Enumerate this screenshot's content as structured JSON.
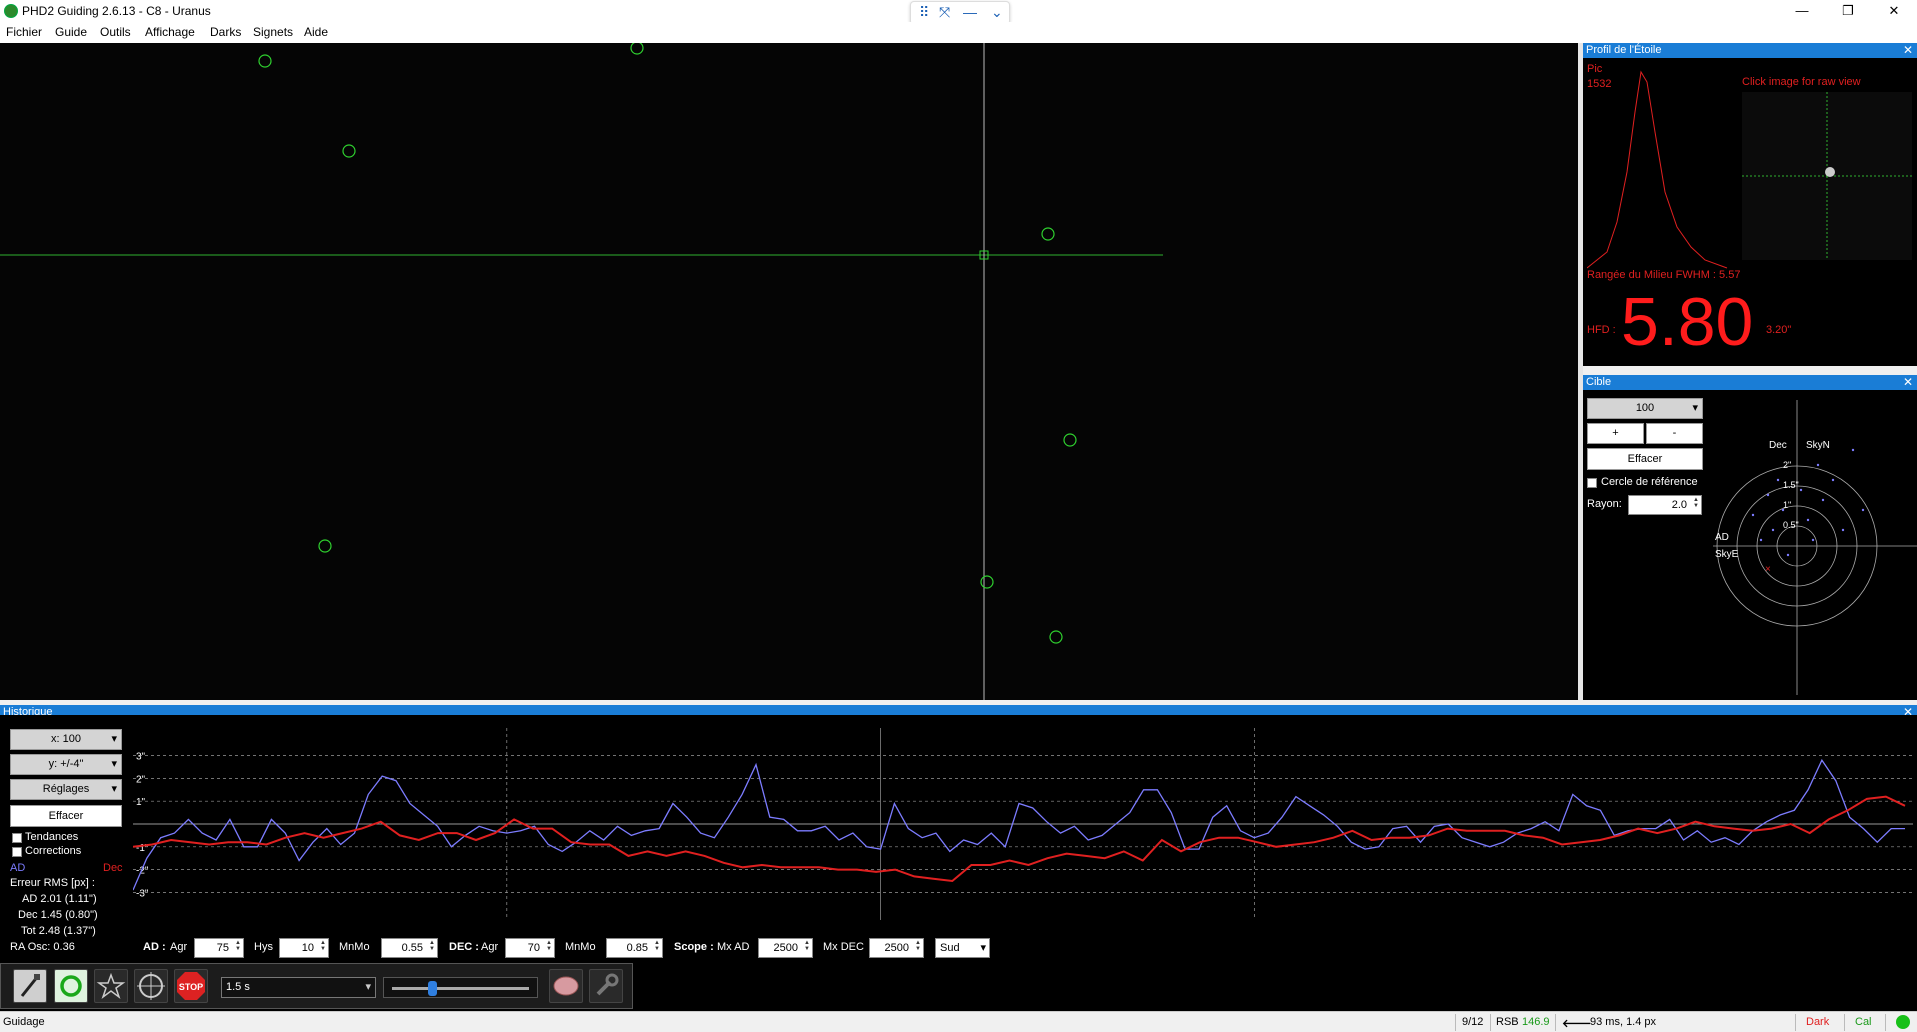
{
  "window": {
    "title": "PHD2 Guiding 2.6.13 - C8 - Uranus",
    "minimize": "—",
    "maximize": "❐",
    "close": "✕"
  },
  "menu": [
    "Fichier",
    "Guide",
    "Outils",
    "Affichage",
    "Darks",
    "Signets",
    "Aide"
  ],
  "profile": {
    "title": "Profil de l'Étoile",
    "close": "✕",
    "peak_label": "Pic",
    "peak_value": "1532",
    "hint": "Click image for raw view",
    "fwhm": "Rangée du Milieu FWHM : 5.57",
    "hfd_label": "HFD :",
    "hfd_value": "5.80",
    "hfd_arcsec": "3.20\""
  },
  "target": {
    "title": "Cible",
    "close": "✕",
    "scale": "100",
    "plus": "+",
    "minus": "-",
    "clear": "Effacer",
    "ref_circle": "Cercle de référence",
    "radius_label": "Rayon:",
    "radius_value": "2.0",
    "dec_label": "Dec",
    "skyn": "SkyN",
    "ad_label": "AD",
    "skye": "SkyE",
    "rings": [
      "2\"",
      "1.5\"",
      "1\"",
      "0.5\""
    ]
  },
  "history": {
    "title": "Historique",
    "close": "✕",
    "x_scale": "x: 100",
    "y_scale": "y: +/-4\"",
    "settings": "Réglages",
    "clear": "Effacer",
    "trends": "Tendances",
    "corrections": "Corrections",
    "ra_legend": "AD",
    "dec_legend": "Dec",
    "rms_title": "Erreur RMS [px] :",
    "rms_ra": "AD 2.01 (1.11\")",
    "rms_dec": "Dec 1.45 (0.80\")",
    "rms_tot": "Tot 2.48 (1.37\")",
    "ra_osc": "RA Osc: 0.36",
    "y_ticks": [
      "3\"",
      "2\"",
      "1\"",
      "-1\"",
      "-2\"",
      "-3\""
    ]
  },
  "params": {
    "ad_label": "AD :",
    "agr_label": "Agr",
    "ad_agr": "75",
    "hys_label": "Hys",
    "hys": "10",
    "mnmo_label": "MnMo",
    "ad_mnmo": "0.55",
    "dec_label": "DEC :",
    "dec_agr": "70",
    "dec_mnmo": "0.85",
    "scope_label": "Scope :",
    "mxad_label": "Mx AD",
    "mxad": "2500",
    "mxdec_label": "Mx DEC",
    "mxdec": "2500",
    "dec_mode": "Sud"
  },
  "toolbar": {
    "exposure": "1.5 s",
    "stop": "STOP"
  },
  "status": {
    "state": "Guidage",
    "frames": "9/12",
    "snr_label": "RSB",
    "snr": "146.9",
    "guide": "93 ms, 1.4 px",
    "dark": "Dark",
    "cal": "Cal"
  },
  "colors": {
    "accent": "#1a7dd6",
    "ra": "#7c7cff",
    "dec": "#e02020",
    "star_marker": "#2fd12f"
  },
  "chart_data": {
    "type": "line",
    "ylim": [
      -4,
      4
    ],
    "series": [
      {
        "name": "AD",
        "values": [
          -2.9,
          -1.5,
          -0.6,
          -0.4,
          0.2,
          -0.4,
          -0.7,
          0.2,
          -1.0,
          -1.0,
          0.2,
          -0.4,
          -1.6,
          -0.8,
          -0.2,
          -0.9,
          -0.4,
          1.3,
          2.1,
          1.9,
          0.9,
          0.4,
          -0.1,
          -1.0,
          -0.5,
          -0.1,
          -0.3,
          -0.4,
          -0.3,
          -0.1,
          -0.9,
          -1.2,
          -0.8,
          -0.3,
          -0.7,
          -0.1,
          -0.5,
          -0.3,
          -0.2,
          0.9,
          0.3,
          -0.4,
          -0.6,
          0.3,
          1.3,
          2.6,
          0.3,
          0.2,
          -0.3,
          -0.3,
          -0.1,
          -0.7,
          -0.4,
          -1.0,
          -1.1,
          0.9,
          -0.2,
          -0.6,
          -0.4,
          -1.2,
          -0.7,
          -0.9,
          -0.4,
          -1.0,
          0.9,
          0.7,
          0.1,
          -0.4,
          -0.1,
          -0.7,
          -0.5,
          0.0,
          0.5,
          1.5,
          1.5,
          0.5,
          -1.1,
          -1.1,
          0.3,
          0.8,
          -0.3,
          -0.6,
          -0.4,
          0.3,
          1.2,
          0.8,
          0.4,
          -0.1,
          -0.8,
          -1.1,
          -1.0,
          -0.2,
          -0.1,
          -0.8,
          -0.1,
          0.0,
          -0.6,
          -0.8,
          -1.0,
          -0.8,
          -0.4,
          -0.2,
          0.1,
          -0.3,
          1.3,
          0.8,
          0.6,
          -0.5,
          -0.3,
          -0.2,
          -0.2,
          0.2,
          -0.7,
          -0.3,
          -0.8,
          -0.6,
          -0.9,
          -0.3,
          0.1,
          0.4,
          0.6,
          1.5,
          2.8,
          1.9,
          0.3,
          -0.2,
          -0.8,
          -0.2,
          -0.2
        ],
        "color": "#7c7cff"
      },
      {
        "name": "Dec",
        "values": [
          -1.0,
          -0.9,
          -0.7,
          -0.8,
          -0.9,
          -0.8,
          -0.8,
          -0.9,
          -0.6,
          -0.4,
          -0.6,
          -0.4,
          -0.2,
          0.1,
          -0.5,
          -0.7,
          -0.4,
          -0.4,
          -0.7,
          -0.4,
          0.2,
          -0.2,
          -0.2,
          -0.8,
          -0.9,
          -0.9,
          -1.4,
          -1.2,
          -1.4,
          -1.2,
          -1.4,
          -1.7,
          -1.9,
          -1.8,
          -1.9,
          -1.9,
          -1.9,
          -2.0,
          -2.0,
          -2.1,
          -2.0,
          -2.3,
          -2.4,
          -2.5,
          -1.8,
          -1.8,
          -1.6,
          -1.8,
          -1.5,
          -1.3,
          -1.4,
          -1.5,
          -1.2,
          -1.6,
          -0.7,
          -1.2,
          -0.8,
          -0.6,
          -0.6,
          -0.8,
          -1.0,
          -0.9,
          -0.8,
          -0.6,
          -0.3,
          -0.7,
          -0.6,
          -0.6,
          -0.5,
          -0.2,
          -0.3,
          -0.3,
          -0.3,
          -0.5,
          -0.6,
          -0.9,
          -0.8,
          -0.7,
          -0.5,
          -0.2,
          -0.4,
          -0.2,
          0.1,
          -0.1,
          -0.2,
          -0.3,
          -0.2,
          0.0,
          -0.4,
          0.2,
          0.6,
          1.1,
          1.2,
          0.8
        ],
        "color": "#e02020"
      }
    ]
  }
}
